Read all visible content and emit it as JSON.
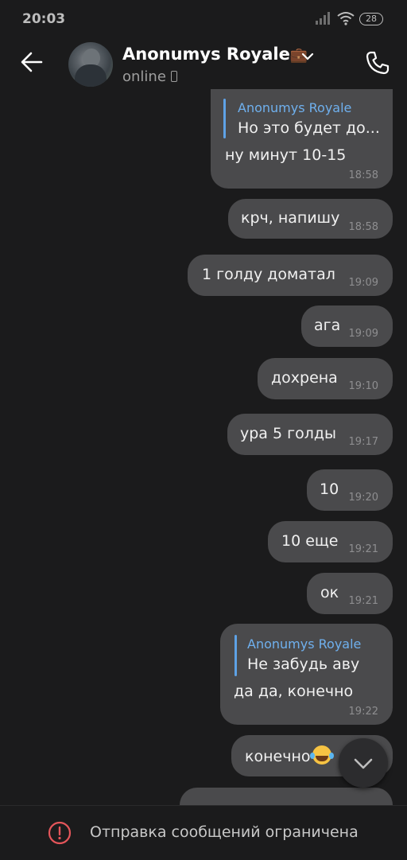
{
  "status_bar": {
    "time": "20:03",
    "battery": "28"
  },
  "header": {
    "contact_name": "Anonumys Royale",
    "contact_emoji": "💼",
    "presence": "online"
  },
  "messages": [
    {
      "reply_author": "Anonumys Royale",
      "reply_text": "Но это будет до...",
      "text": "ну минут 10-15",
      "time": "18:58"
    },
    {
      "text": "крч, напишу",
      "time": "18:58"
    },
    {
      "text": "1 голду доматал",
      "time": "19:09"
    },
    {
      "text": "ага",
      "time": "19:09"
    },
    {
      "text": "дохрена",
      "time": "19:10"
    },
    {
      "text": "ура 5 голды",
      "time": "19:17"
    },
    {
      "text": "10",
      "time": "19:20"
    },
    {
      "text": "10 еще",
      "time": "19:21"
    },
    {
      "text": "ок",
      "time": "19:21"
    },
    {
      "reply_author": "Anonumys Royale",
      "reply_text": "Не забудь аву",
      "text": "да да, конечно",
      "time": "19:22"
    },
    {
      "text": "конечно",
      "emoji": "laughing-tears"
    }
  ],
  "bottom_bar": {
    "label": "Отправка сообщений ограничена"
  },
  "colors": {
    "bubble": "#4a4a4c",
    "background": "#1b1b1c",
    "reply_accent": "#5ea2e6",
    "warning": "#e4555a"
  }
}
